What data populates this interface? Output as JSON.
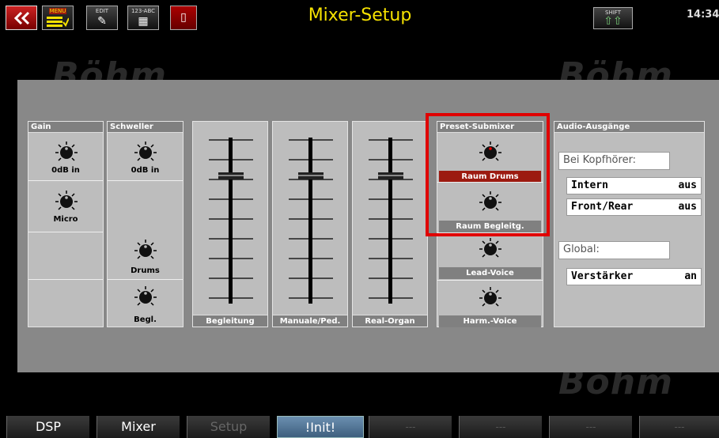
{
  "window": {
    "title": "Mixer-Setup",
    "clock": "14:34"
  },
  "topbar": {
    "back_icon": "double-chevron-left-icon",
    "menu_label": "MENU",
    "edit_label": "EDIT",
    "abc_label": "123-ABC",
    "delete_icon": "trash-icon",
    "shift_label": "SHIFT"
  },
  "background_logo": "Böhm",
  "groups": {
    "gain": {
      "header": "Gain",
      "knobs": [
        {
          "label": "0dB in"
        },
        {
          "label": "Micro"
        }
      ]
    },
    "schweller": {
      "header": "Schweller",
      "knobs": [
        {
          "label": "0dB in"
        },
        {
          "label": "Drums"
        },
        {
          "label": "Begl."
        }
      ]
    }
  },
  "faders": [
    {
      "label": "Begleitung"
    },
    {
      "label": "Manuale/Ped."
    },
    {
      "label": "Real-Organ"
    }
  ],
  "preset_submixer": {
    "header": "Preset-Submixer",
    "items": [
      {
        "label": "Raum Drums",
        "active": true
      },
      {
        "label": "Raum Begleitg.",
        "active": false
      },
      {
        "label": "Lead-Voice",
        "active": false
      },
      {
        "label": "Harm.-Voice",
        "active": false
      }
    ]
  },
  "audio_outputs": {
    "header": "Audio-Ausgänge",
    "headphone_label": "Bei Kopfhörer:",
    "rows_headphone": [
      {
        "name": "Intern",
        "value": "aus"
      },
      {
        "name": "Front/Rear",
        "value": "aus"
      }
    ],
    "global_label": "Global:",
    "rows_global": [
      {
        "name": "Verstärker",
        "value": "an"
      }
    ]
  },
  "softkeys": [
    "DSP",
    "Mixer",
    "Setup",
    "!Init!",
    "---",
    "---",
    "---",
    "---"
  ],
  "colors": {
    "title": "#f5e100",
    "highlight": "#e00000",
    "active_label": "#9c1a10"
  }
}
